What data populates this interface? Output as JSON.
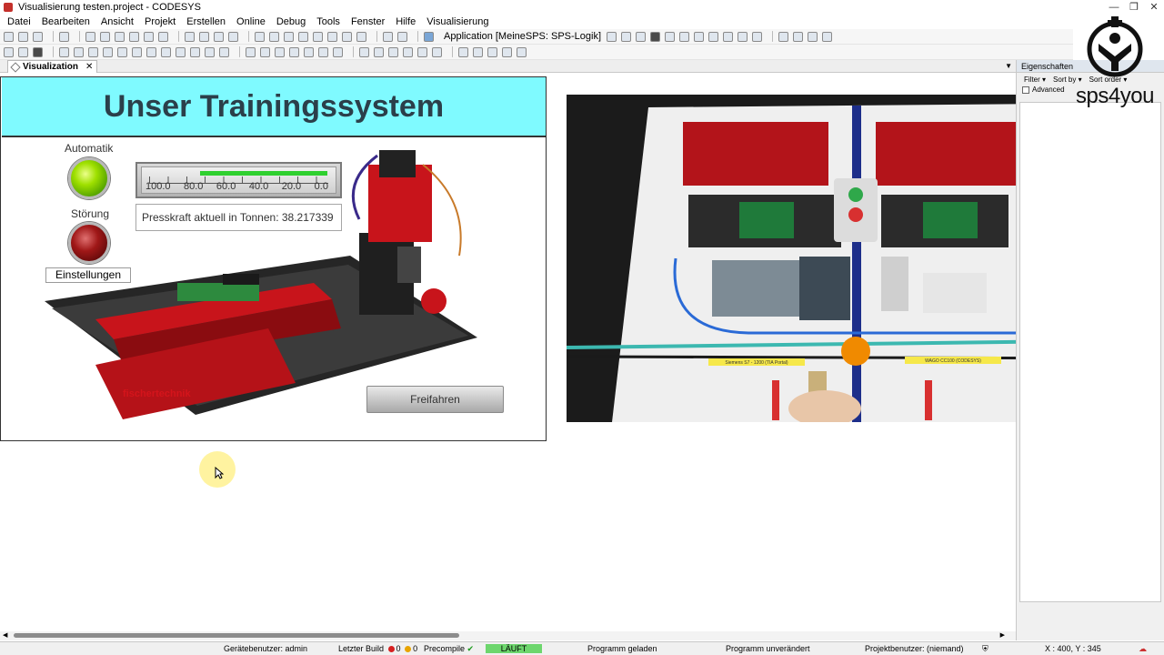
{
  "window": {
    "title": "Visualisierung testen.project - CODESYS"
  },
  "menu": [
    "Datei",
    "Bearbeiten",
    "Ansicht",
    "Projekt",
    "Erstellen",
    "Online",
    "Debug",
    "Tools",
    "Fenster",
    "Hilfe",
    "Visualisierung"
  ],
  "toolbar": {
    "application": "Application [MeineSPS: SPS-Logik]"
  },
  "tabs": [
    {
      "label": "Visualization"
    }
  ],
  "visualization": {
    "header": "Unser Trainingssystem",
    "automatik_label": "Automatik",
    "stoerung_label": "Störung",
    "settings_button": "Einstellungen",
    "gauge": {
      "labels": [
        "100.0",
        "80.0",
        "60.0",
        "40.0",
        "20.0",
        "0.0"
      ],
      "fill_start_fraction": 0.3,
      "fill_end_fraction": 0.96
    },
    "press_text": "Presskraft aktuell in Tonnen: 38.217339",
    "release_button": "Freifahren",
    "brand_text": "fischertechnik"
  },
  "photo": {
    "label_siemens": "Siemens S7 - 1200 (TIA Portal)",
    "label_wago": "WAGO CC100 (CODESYS)"
  },
  "properties": {
    "title": "Eigenschaften",
    "filter": "Filter",
    "sort_by": "Sort by",
    "sort_order": "Sort order",
    "advanced": "Advanced"
  },
  "logo": {
    "text": "sps4you"
  },
  "status": {
    "device_user": "Gerätebenutzer: admin",
    "last_build": "Letzter Build",
    "build_errors": "0",
    "build_warnings": "0",
    "precompile": "Precompile",
    "precompile_check": "✔",
    "running": "LÄUFT",
    "program_loaded": "Programm geladen",
    "program_unchanged": "Programm unverändert",
    "project_user": "Projektbenutzer: (niemand)",
    "coords": "X : 400, Y : 345"
  },
  "colors": {
    "header_bg": "#7ffaff",
    "status_running": "#6dd66d",
    "gauge_fill": "#2fd02f"
  }
}
